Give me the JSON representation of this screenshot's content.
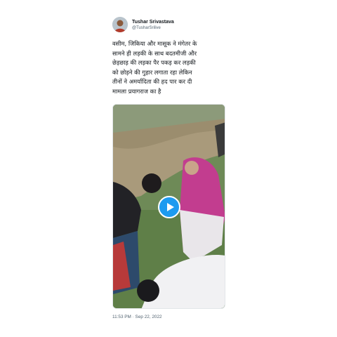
{
  "tweet": {
    "author": {
      "display_name": "Tushar Srivastava",
      "handle": "@TusharSrilive",
      "avatar_icon": "user-avatar-photo"
    },
    "text": "वसीम, जिकिया और मासूक ने मंगेतर के\nसामने ही लड़की के साथ बदतमीजी और\nछेड़छाड़ की लड़का पैर पकड़ कर लड़की\nको छोड़ने की गुहार लगाता रहा लेकिन\nतीनों ने अमर्यादिता की हद पार कर दी\nमामला प्रयागराज का है",
    "media": {
      "type": "video",
      "play_icon": "play-icon",
      "accent_color": "#1d9bf0"
    },
    "timestamp": "11:53 PM · Sep 22, 2022"
  }
}
